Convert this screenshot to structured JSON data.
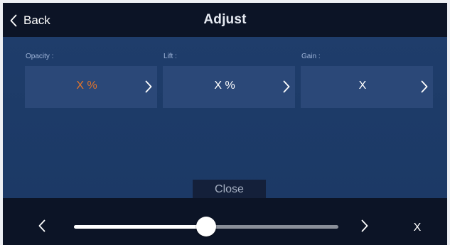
{
  "header": {
    "back_label": "Back",
    "title": "Adjust"
  },
  "params": [
    {
      "label": "Opacity :",
      "value": "X %",
      "value_color": "#e0742c"
    },
    {
      "label": "Lift :",
      "value": "X %"
    },
    {
      "label": "Gain :",
      "value": "X"
    }
  ],
  "close_label": "Close",
  "slider": {
    "level": 0.5,
    "readout": "X"
  },
  "icons": {
    "back": "chevron-left-icon",
    "param_next": "chevron-right-icon",
    "slider_prev": "chevron-left-icon",
    "slider_next": "chevron-right-icon"
  },
  "colors": {
    "header_bg": "#0c1426",
    "panel_bg": "#1f3d6b",
    "box_bg": "#2b4878",
    "accent": "#e0742c"
  }
}
